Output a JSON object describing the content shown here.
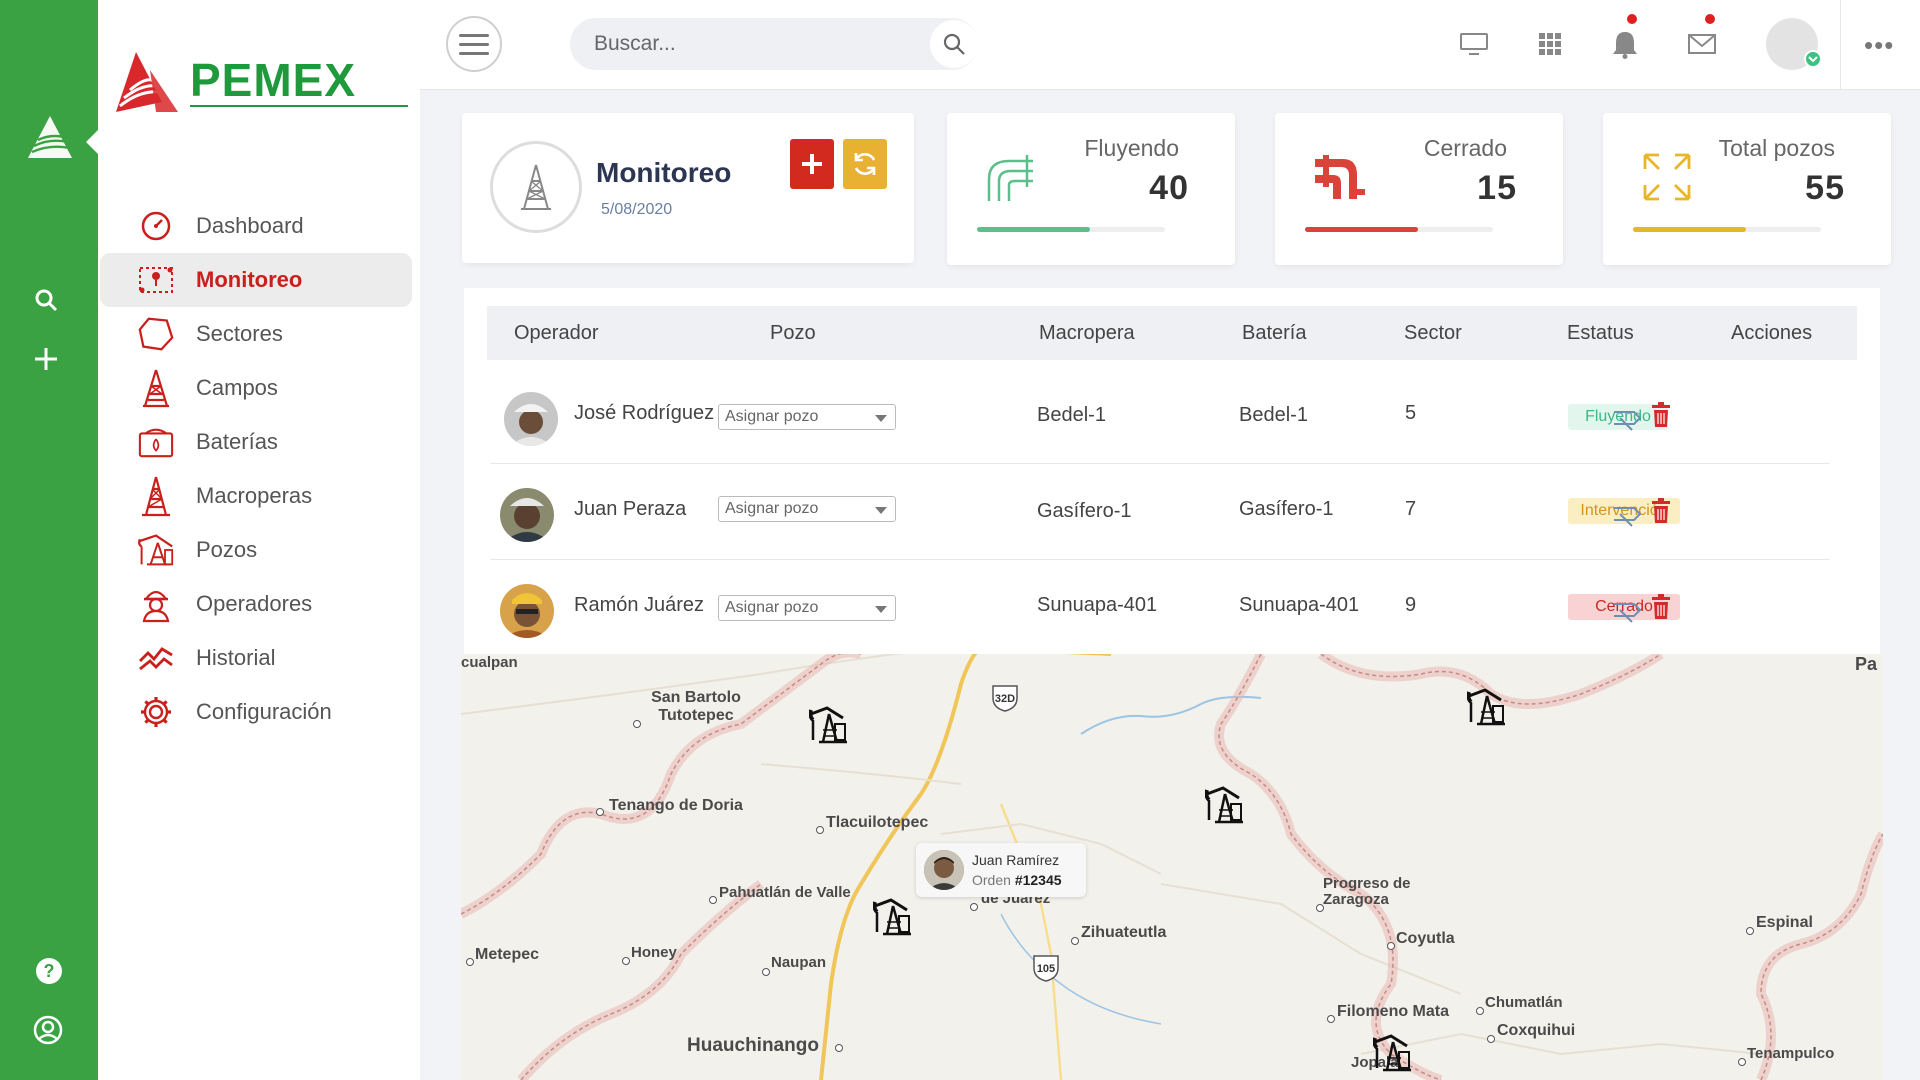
{
  "app": {
    "brand": "PEMEX"
  },
  "search": {
    "placeholder": "Buscar..."
  },
  "nav": {
    "items": [
      {
        "label": "Dashboard",
        "icon": "speedometer-icon"
      },
      {
        "label": "Monitoreo",
        "icon": "map-route-icon",
        "active": true
      },
      {
        "label": "Sectores",
        "icon": "polygon-icon"
      },
      {
        "label": "Campos",
        "icon": "oil-tower-icon"
      },
      {
        "label": "Baterías",
        "icon": "battery-tank-icon"
      },
      {
        "label": "Macroperas",
        "icon": "oil-derrick-icon"
      },
      {
        "label": "Pozos",
        "icon": "pumpjack-icon"
      },
      {
        "label": "Operadores",
        "icon": "operator-icon"
      },
      {
        "label": "Historial",
        "icon": "trend-chart-icon"
      },
      {
        "label": "Configuración",
        "icon": "gear-icon"
      }
    ]
  },
  "header_card": {
    "title": "Monitoreo",
    "date": "5/08/2020"
  },
  "stats": [
    {
      "label": "Fluyendo",
      "value": "40",
      "progress": 0.6,
      "color": "#5cbf8a"
    },
    {
      "label": "Cerrado",
      "value": "15",
      "progress": 0.6,
      "color": "#d9433a"
    },
    {
      "label": "Total pozos",
      "value": "55",
      "progress": 0.6,
      "color": "#e8b52b"
    }
  ],
  "table": {
    "columns": [
      "Operador",
      "Pozo",
      "Macropera",
      "Batería",
      "Sector",
      "Estatus",
      "Acciones"
    ],
    "rows": [
      {
        "operador": "José Rodríguez",
        "pozo": "Asignar pozo",
        "macropera": "Bedel-1",
        "bateria": "Bedel-1",
        "sector": "5",
        "estatus": "Fluyendo"
      },
      {
        "operador": "Juan Peraza",
        "pozo": "Asignar pozo",
        "macropera": "Gasífero-1",
        "bateria": "Gasífero-1",
        "sector": "7",
        "estatus": "Intervención"
      },
      {
        "operador": "Ramón Juárez",
        "pozo": "Asignar pozo",
        "macropera": "Sunuapa-401",
        "bateria": "Sunuapa-401",
        "sector": "9",
        "estatus": "Cerrado"
      }
    ]
  },
  "status_colors": {
    "Fluyendo": {
      "bg": "#e2f6ee",
      "fg": "#3cb887"
    },
    "Intervención": {
      "bg": "#fbeec2",
      "fg": "#d0961a"
    },
    "Cerrado": {
      "bg": "#f9d3d3",
      "fg": "#c42a2a"
    }
  },
  "map": {
    "places": [
      "cualpan",
      "San Bartolo Tutotepec",
      "Tenango de Doria",
      "Tlacuilotepec",
      "Pahuatlán de Valle",
      "de Juárez",
      "Metepec",
      "Honey",
      "Naupan",
      "Huauchinango",
      "Zihuateutla",
      "Progreso de Zaragoza",
      "Coyutla",
      "Filomeno Mata",
      "Chumatlán",
      "Coxquihui",
      "Espinal",
      "Tenampulco",
      "Jopala",
      "Pa"
    ],
    "highways": [
      "32D",
      "105"
    ],
    "popup": {
      "name": "Juan Ramírez",
      "order_label": "Orden",
      "order_number": "#12345"
    }
  },
  "colors": {
    "rail": "#3aa242",
    "accent_red": "#c9201c",
    "brand_green": "#1e9a3c"
  }
}
